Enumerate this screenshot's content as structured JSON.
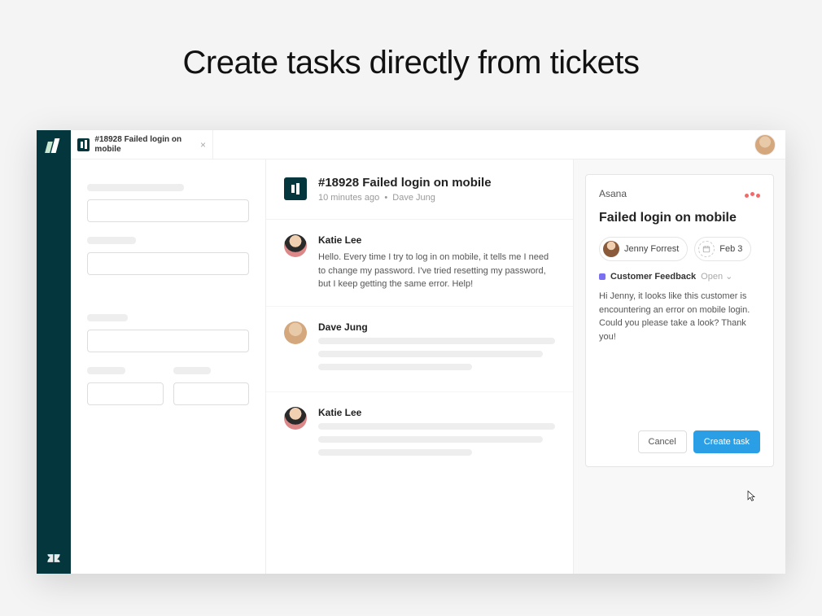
{
  "hero": {
    "title": "Create tasks directly from tickets"
  },
  "tab": {
    "title": "#18928 Failed login on mobile"
  },
  "ticket": {
    "title": "#18928 Failed login on mobile",
    "time": "10 minutes ago",
    "requester": "Dave Jung"
  },
  "messages": [
    {
      "author": "Katie Lee",
      "text": "Hello. Every time I try to log in on mobile, it tells me I need to change my password. I've tried resetting my password, but I keep getting the same error. Help!"
    },
    {
      "author": "Dave Jung",
      "text": ""
    },
    {
      "author": "Katie Lee",
      "text": ""
    }
  ],
  "asana": {
    "panel_label": "Asana",
    "task_title": "Failed login on mobile",
    "assignee": "Jenny Forrest",
    "due": "Feb 3",
    "project": "Customer Feedback",
    "status": "Open",
    "description": "Hi Jenny, it looks like this customer is encountering an error on mobile login. Could you please take a look? Thank you!",
    "cancel": "Cancel",
    "create": "Create task"
  }
}
